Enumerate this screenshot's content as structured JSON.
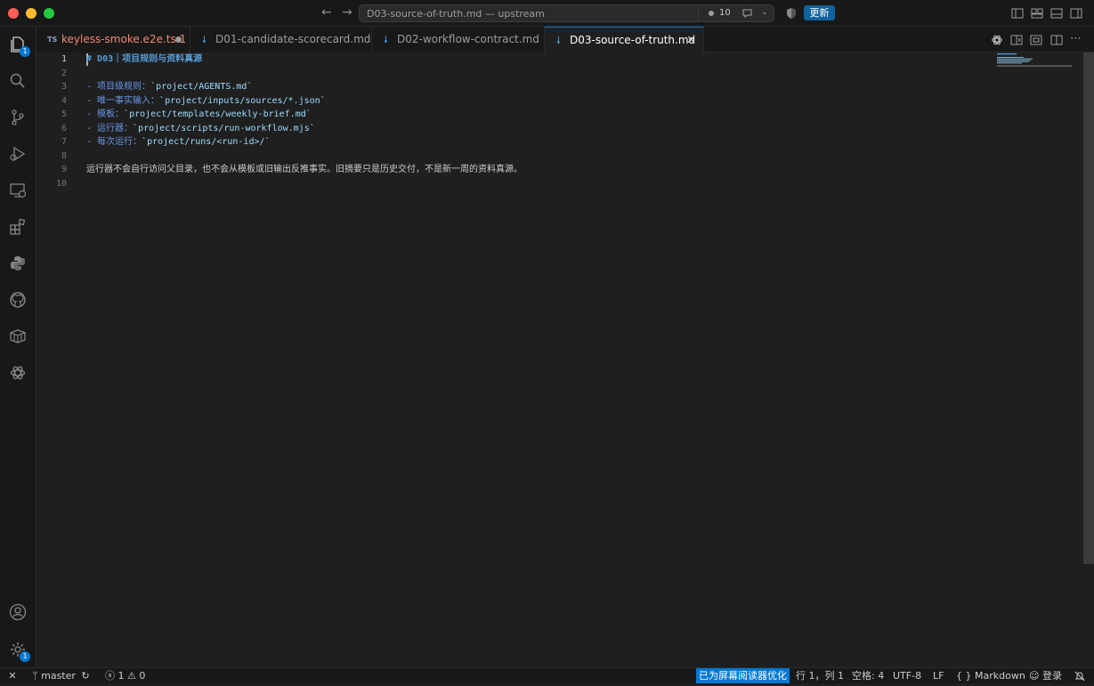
{
  "window": {
    "command_center_title": "D03-source-of-truth.md — upstream",
    "sync_count": "10",
    "update_label": "更新"
  },
  "activity": {
    "explorer_badge": "1",
    "settings_badge": "1"
  },
  "tabs": [
    {
      "type": "TS",
      "label": "keyless-smoke.e2e.ts",
      "problems": "1",
      "dirty": true
    },
    {
      "label": "D01-candidate-scorecard.md"
    },
    {
      "label": "D02-workflow-contract.md"
    },
    {
      "label": "D03-source-of-truth.md",
      "active": true
    }
  ],
  "editor": {
    "line_numbers": [
      "1",
      "2",
      "3",
      "4",
      "5",
      "6",
      "7",
      "8",
      "9",
      "10"
    ],
    "lines": {
      "l1_hash": "#",
      "l1_text": " D03｜项目规则与资料真源",
      "l3_prefix": "- 项目级规则：",
      "l3_code": "`project/AGENTS.md`",
      "l4_prefix": "- 唯一事实输入：",
      "l4_code": "`project/inputs/sources/*.json`",
      "l5_prefix": "- 模板：",
      "l5_code": "`project/templates/weekly-brief.md`",
      "l6_prefix": "- 运行器：",
      "l6_code": "`project/scripts/run-workflow.mjs`",
      "l7_prefix": "- 每次运行：",
      "l7_code": "`project/runs/<run-id>/`",
      "l9_text": "运行器不会自行访问父目录，也不会从模板或旧输出反推事实。旧摘要只是历史交付，不是新一周的资料真源。"
    }
  },
  "statusbar": {
    "branch": "master",
    "errors": "1",
    "warnings": "0",
    "screen_reader": "已为屏幕阅读器优化",
    "position": "行 1，列 1",
    "spaces": "空格: 4",
    "encoding": "UTF-8",
    "eol": "LF",
    "language": "Markdown",
    "signin": "登录"
  }
}
